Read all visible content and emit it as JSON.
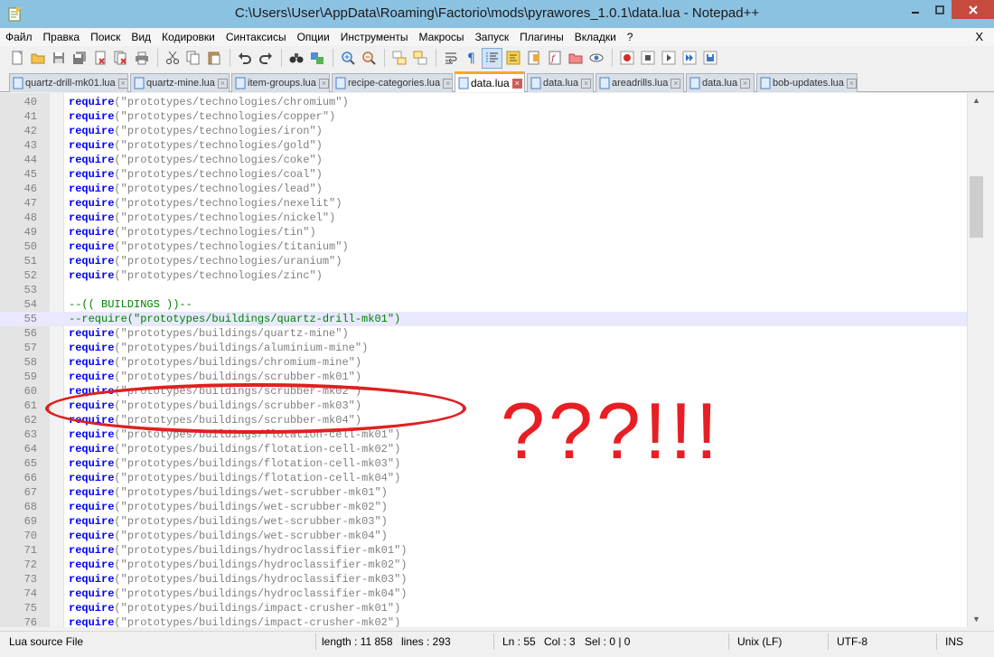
{
  "window": {
    "title": "C:\\Users\\User\\AppData\\Roaming\\Factorio\\mods\\pyrawores_1.0.1\\data.lua - Notepad++"
  },
  "menu": [
    "Файл",
    "Правка",
    "Поиск",
    "Вид",
    "Кодировки",
    "Синтаксисы",
    "Опции",
    "Инструменты",
    "Макросы",
    "Запуск",
    "Плагины",
    "Вкладки",
    "?"
  ],
  "menu_close": "X",
  "toolbar": [
    "new-file",
    "open-file",
    "save",
    "save-all",
    "close",
    "close-all",
    "print",
    "cut",
    "copy",
    "paste",
    "undo",
    "redo",
    "find",
    "replace",
    "zoom-in",
    "zoom-out",
    "sync-vertical",
    "sync-horizontal",
    "word-wrap",
    "show-all-chars",
    "indent-guide",
    "user-defined-language",
    "document-map",
    "function-list",
    "folder-as-workspace",
    "monitoring",
    "record-macro",
    "stop-recording",
    "playback-macro",
    "run-macro-multiple",
    "save-macro"
  ],
  "tabs": [
    {
      "label": "quartz-drill-mk01.lua",
      "active": false
    },
    {
      "label": "quartz-mine.lua",
      "active": false
    },
    {
      "label": "item-groups.lua",
      "active": false
    },
    {
      "label": "recipe-categories.lua",
      "active": false
    },
    {
      "label": "data.lua",
      "active": true
    },
    {
      "label": "data.lua",
      "active": false
    },
    {
      "label": "areadrills.lua",
      "active": false
    },
    {
      "label": "data.lua",
      "active": false
    },
    {
      "label": "bob-updates.lua",
      "active": false
    }
  ],
  "code_lines": [
    {
      "num": "40",
      "kind": "req",
      "kw": "require",
      "arg": "(\"prototypes/technologies/chromium\")"
    },
    {
      "num": "41",
      "kind": "req",
      "kw": "require",
      "arg": "(\"prototypes/technologies/copper\")"
    },
    {
      "num": "42",
      "kind": "req",
      "kw": "require",
      "arg": "(\"prototypes/technologies/iron\")"
    },
    {
      "num": "43",
      "kind": "req",
      "kw": "require",
      "arg": "(\"prototypes/technologies/gold\")"
    },
    {
      "num": "44",
      "kind": "req",
      "kw": "require",
      "arg": "(\"prototypes/technologies/coke\")"
    },
    {
      "num": "45",
      "kind": "req",
      "kw": "require",
      "arg": "(\"prototypes/technologies/coal\")"
    },
    {
      "num": "46",
      "kind": "req",
      "kw": "require",
      "arg": "(\"prototypes/technologies/lead\")"
    },
    {
      "num": "47",
      "kind": "req",
      "kw": "require",
      "arg": "(\"prototypes/technologies/nexelit\")"
    },
    {
      "num": "48",
      "kind": "req",
      "kw": "require",
      "arg": "(\"prototypes/technologies/nickel\")"
    },
    {
      "num": "49",
      "kind": "req",
      "kw": "require",
      "arg": "(\"prototypes/technologies/tin\")"
    },
    {
      "num": "50",
      "kind": "req",
      "kw": "require",
      "arg": "(\"prototypes/technologies/titanium\")"
    },
    {
      "num": "51",
      "kind": "req",
      "kw": "require",
      "arg": "(\"prototypes/technologies/uranium\")"
    },
    {
      "num": "52",
      "kind": "req",
      "kw": "require",
      "arg": "(\"prototypes/technologies/zinc\")"
    },
    {
      "num": "53",
      "kind": "blank",
      "text": ""
    },
    {
      "num": "54",
      "kind": "comment",
      "text": "--(( BUILDINGS ))--"
    },
    {
      "num": "55",
      "kind": "comment",
      "text": "--require(\"prototypes/buildings/quartz-drill-mk01\")",
      "current": true
    },
    {
      "num": "56",
      "kind": "req",
      "kw": "require",
      "arg": "(\"prototypes/buildings/quartz-mine\")"
    },
    {
      "num": "57",
      "kind": "req",
      "kw": "require",
      "arg": "(\"prototypes/buildings/aluminium-mine\")"
    },
    {
      "num": "58",
      "kind": "req",
      "kw": "require",
      "arg": "(\"prototypes/buildings/chromium-mine\")"
    },
    {
      "num": "59",
      "kind": "req",
      "kw": "require",
      "arg": "(\"prototypes/buildings/scrubber-mk01\")"
    },
    {
      "num": "60",
      "kind": "req",
      "kw": "require",
      "arg": "(\"prototypes/buildings/scrubber-mk02\")"
    },
    {
      "num": "61",
      "kind": "req",
      "kw": "require",
      "arg": "(\"prototypes/buildings/scrubber-mk03\")"
    },
    {
      "num": "62",
      "kind": "req",
      "kw": "require",
      "arg": "(\"prototypes/buildings/scrubber-mk04\")"
    },
    {
      "num": "63",
      "kind": "req",
      "kw": "require",
      "arg": "(\"prototypes/buildings/flotation-cell-mk01\")"
    },
    {
      "num": "64",
      "kind": "req",
      "kw": "require",
      "arg": "(\"prototypes/buildings/flotation-cell-mk02\")"
    },
    {
      "num": "65",
      "kind": "req",
      "kw": "require",
      "arg": "(\"prototypes/buildings/flotation-cell-mk03\")"
    },
    {
      "num": "66",
      "kind": "req",
      "kw": "require",
      "arg": "(\"prototypes/buildings/flotation-cell-mk04\")"
    },
    {
      "num": "67",
      "kind": "req",
      "kw": "require",
      "arg": "(\"prototypes/buildings/wet-scrubber-mk01\")"
    },
    {
      "num": "68",
      "kind": "req",
      "kw": "require",
      "arg": "(\"prototypes/buildings/wet-scrubber-mk02\")"
    },
    {
      "num": "69",
      "kind": "req",
      "kw": "require",
      "arg": "(\"prototypes/buildings/wet-scrubber-mk03\")"
    },
    {
      "num": "70",
      "kind": "req",
      "kw": "require",
      "arg": "(\"prototypes/buildings/wet-scrubber-mk04\")"
    },
    {
      "num": "71",
      "kind": "req",
      "kw": "require",
      "arg": "(\"prototypes/buildings/hydroclassifier-mk01\")"
    },
    {
      "num": "72",
      "kind": "req",
      "kw": "require",
      "arg": "(\"prototypes/buildings/hydroclassifier-mk02\")"
    },
    {
      "num": "73",
      "kind": "req",
      "kw": "require",
      "arg": "(\"prototypes/buildings/hydroclassifier-mk03\")"
    },
    {
      "num": "74",
      "kind": "req",
      "kw": "require",
      "arg": "(\"prototypes/buildings/hydroclassifier-mk04\")"
    },
    {
      "num": "75",
      "kind": "req",
      "kw": "require",
      "arg": "(\"prototypes/buildings/impact-crusher-mk01\")"
    },
    {
      "num": "76",
      "kind": "req",
      "kw": "require",
      "arg": "(\"prototypes/buildings/impact-crusher-mk02\")"
    }
  ],
  "annotation": {
    "text": "???!!!",
    "color": "#e81e25"
  },
  "status": {
    "file_type": "Lua source File",
    "length": "length : 11 858",
    "lines": "lines : 293",
    "ln": "Ln : 55",
    "col": "Col : 3",
    "sel": "Sel : 0 | 0",
    "eol": "Unix (LF)",
    "encoding": "UTF-8",
    "mode": "INS"
  }
}
